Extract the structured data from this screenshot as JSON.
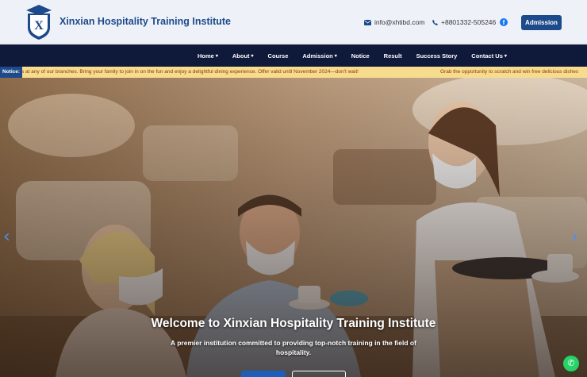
{
  "header": {
    "brand_name": "Xinxian Hospitality Training Institute",
    "logo_letter": "X",
    "email": "info@xhtibd.com",
    "phone": "+8801332-505246",
    "facebook_icon": "facebook-icon",
    "admission_button": "Admission"
  },
  "nav": {
    "items": [
      {
        "label": "Home",
        "dropdown": true
      },
      {
        "label": "About",
        "dropdown": true
      },
      {
        "label": "Course",
        "dropdown": false
      },
      {
        "label": "Admission",
        "dropdown": true
      },
      {
        "label": "Notice",
        "dropdown": false
      },
      {
        "label": "Result",
        "dropdown": false
      },
      {
        "label": "Success Story",
        "dropdown": false
      },
      {
        "label": "Contact Us",
        "dropdown": true
      }
    ]
  },
  "notice": {
    "label": "Notice:",
    "text_1": "s at any of our branches. Bring your family to join in on the fun and enjoy a delightful dining experience. Offer valid until November 2024—don't wait!",
    "text_2": "Grab the opportunity to scratch and win free delicious dishes"
  },
  "hero": {
    "title": "Welcome to Xinxian Hospitality Training Institute",
    "subtitle": "A premier institution committed to providing top-notch training in the field of hospitality.",
    "prev_arrow": "‹",
    "next_arrow": "›"
  },
  "colors": {
    "brand_blue": "#1d4a8a",
    "nav_bg": "#0f1a3a",
    "notice_bg": "#f6dc8c",
    "whatsapp_green": "#25d366"
  },
  "whatsapp": {
    "icon": "whatsapp-icon",
    "glyph": "✆"
  }
}
